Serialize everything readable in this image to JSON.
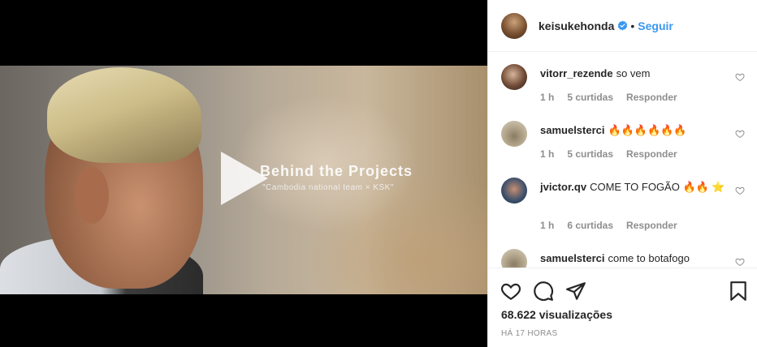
{
  "video": {
    "title": "Behind the Projects",
    "subtitle": "\"Cambodia national team × KSK\""
  },
  "post": {
    "username": "keisukehonda",
    "separator": "•",
    "follow_label": "Seguir",
    "verified_color": "#3897f0"
  },
  "comments": [
    {
      "user": "vitorr_rezende",
      "text": "so vem",
      "time": "1 h",
      "likes": "5 curtidas",
      "reply": "Responder"
    },
    {
      "user": "samuelsterci",
      "text": "🔥🔥🔥🔥🔥🔥",
      "time": "1 h",
      "likes": "5 curtidas",
      "reply": "Responder"
    },
    {
      "user": "jvictor.qv",
      "text": "COME TO FOGÃO 🔥🔥 ⭐",
      "time": "1 h",
      "likes": "6 curtidas",
      "reply": "Responder"
    },
    {
      "user": "samuelsterci",
      "text": "come to botafogo"
    }
  ],
  "stats": {
    "views": "68.622 visualizações",
    "timestamp": "HÁ 17 HORAS"
  },
  "icons": [
    "heart-icon",
    "comment-icon",
    "share-icon",
    "bookmark-icon",
    "play-icon",
    "verified-icon"
  ],
  "colors": {
    "link": "#3897f0",
    "muted": "#8e8e8e",
    "border": "#efefef"
  }
}
